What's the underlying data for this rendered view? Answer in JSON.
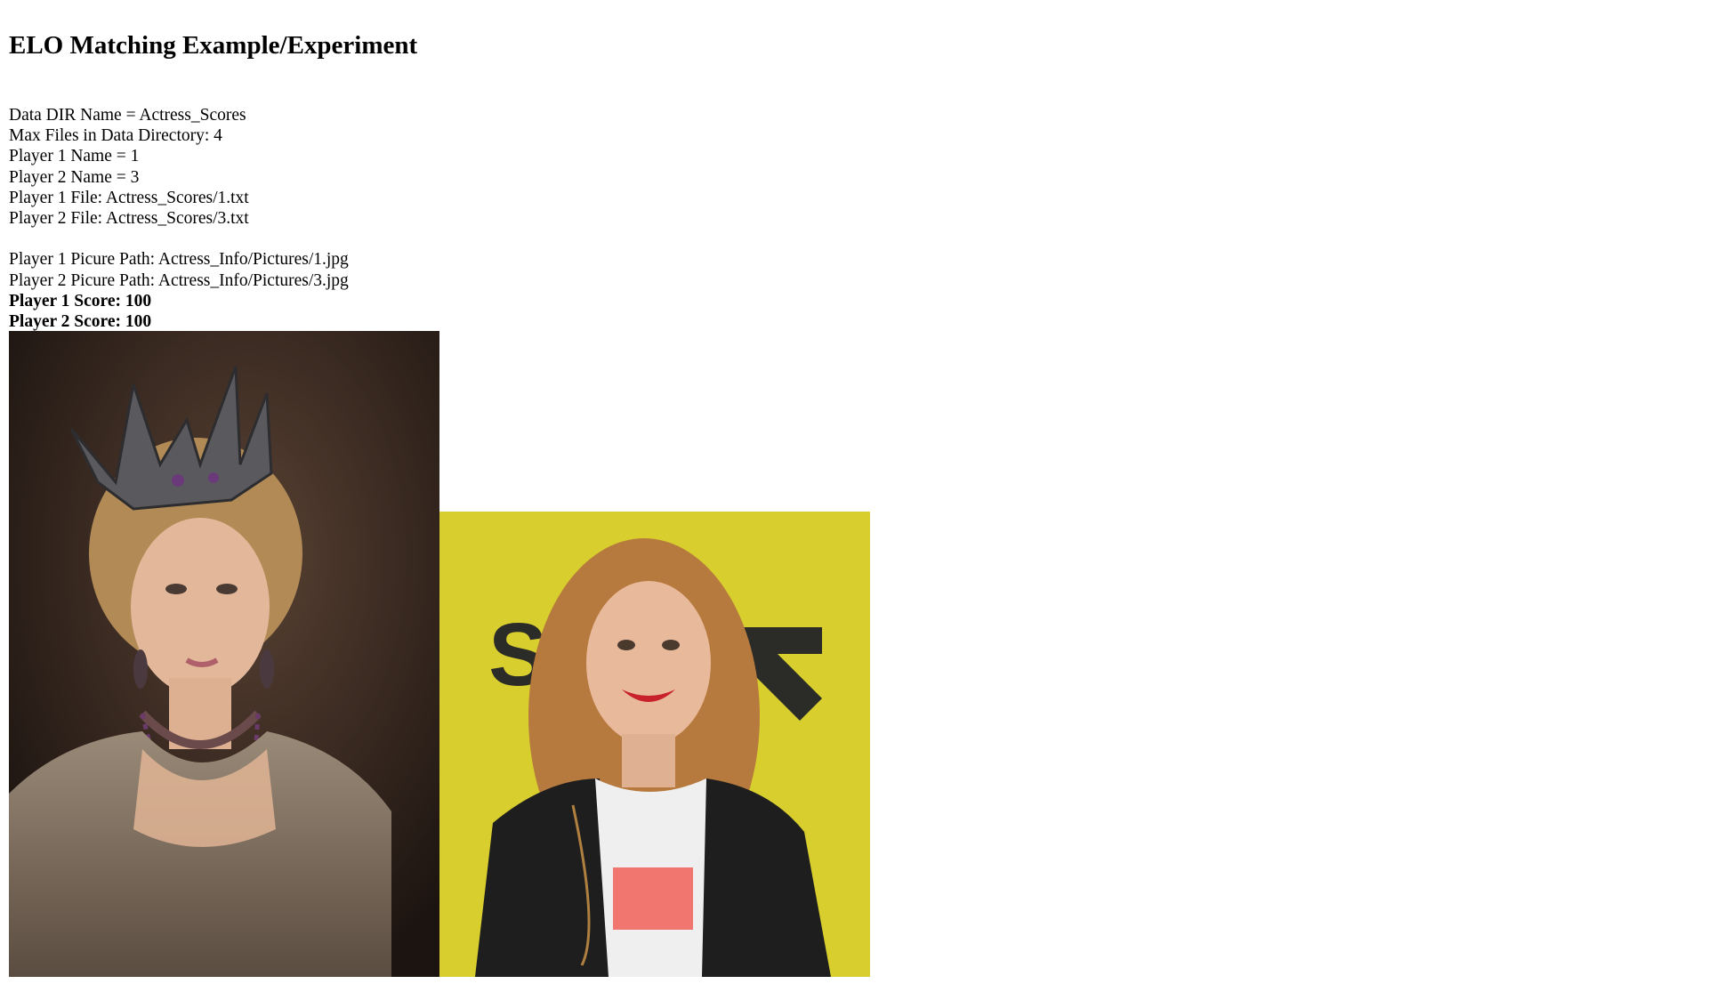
{
  "page": {
    "title": "ELO Matching Example/Experiment"
  },
  "info": {
    "data_dir": "Data DIR Name = Actress_Scores",
    "max_files": "Max Files in Data Directory: 4",
    "player1_name": "Player 1 Name = 1",
    "player2_name": "Player 2 Name = 3",
    "player1_file": "Player 1 File: Actress_Scores/1.txt",
    "player2_file": "Player 2 File: Actress_Scores/3.txt",
    "player1_picture": "Player 1 Picure Path: Actress_Info/Pictures/1.jpg",
    "player2_picture": "Player 2 Picure Path: Actress_Info/Pictures/3.jpg",
    "player1_score": "Player 1 Score: 100",
    "player2_score": "Player 2 Score: 100"
  },
  "pictures": {
    "player1": {
      "icon": "actress-photo-1",
      "backdrop": "#3b2a22"
    },
    "player2": {
      "icon": "actress-photo-3",
      "backdrop": "#d8ce2e",
      "backdrop_text": "SX"
    }
  }
}
